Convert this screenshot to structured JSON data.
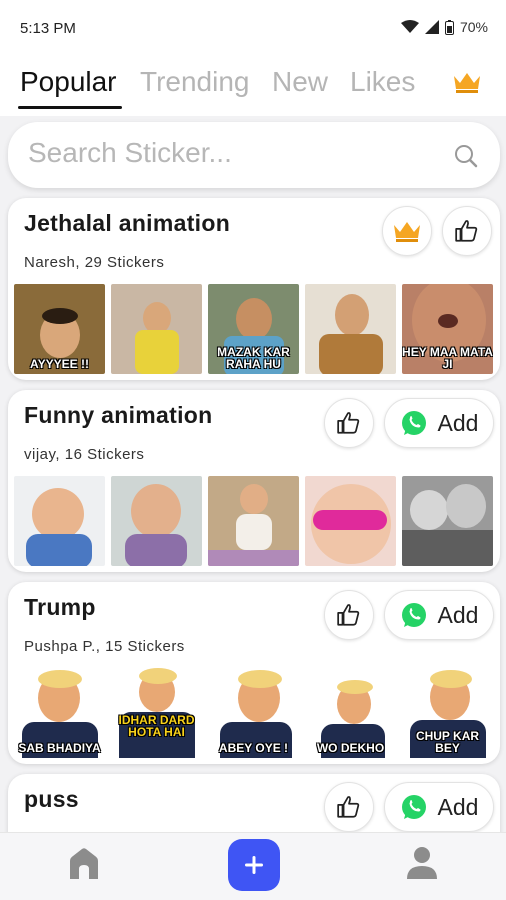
{
  "status": {
    "time": "5:13 PM",
    "battery": "70%"
  },
  "tabs": [
    {
      "label": "Popular",
      "active": true
    },
    {
      "label": "Trending",
      "active": false
    },
    {
      "label": "New",
      "active": false
    },
    {
      "label": "Likes",
      "active": false
    }
  ],
  "icons": {
    "premium": "crown-icon",
    "search": "search-icon",
    "like": "thumbs-up-icon",
    "whatsapp": "whatsapp-icon",
    "home": "home-icon",
    "add": "plus-icon",
    "profile": "person-icon"
  },
  "colors": {
    "accent": "#3f55f4",
    "crown": "#f5a623",
    "whatsapp": "#25d366"
  },
  "search": {
    "placeholder": "Search Sticker..."
  },
  "packs": [
    {
      "title": "Jethalal animation",
      "subtitle": "Naresh, 29 Stickers",
      "premium": true,
      "stickers": [
        {
          "caption": "AYYYEE !!"
        },
        {
          "caption": ""
        },
        {
          "caption": "MAZAK KAR RAHA HU"
        },
        {
          "caption": ""
        },
        {
          "caption": "HEY MAA MATA JI"
        }
      ]
    },
    {
      "title": "Funny animation",
      "subtitle": "vijay, 16 Stickers",
      "add_label": "Add",
      "stickers": [
        {
          "caption": ""
        },
        {
          "caption": ""
        },
        {
          "caption": ""
        },
        {
          "caption": ""
        },
        {
          "caption": ""
        }
      ]
    },
    {
      "title": "Trump",
      "subtitle": "Pushpa P., 15 Stickers",
      "add_label": "Add",
      "stickers": [
        {
          "caption": "SAB BHADIYA"
        },
        {
          "caption": "IDHAR DARD HOTA HAI"
        },
        {
          "caption": "ABEY OYE !"
        },
        {
          "caption": "WO DEKHO"
        },
        {
          "caption": "CHUP KAR BEY"
        }
      ]
    },
    {
      "title": "puss",
      "add_label": "Add"
    }
  ]
}
